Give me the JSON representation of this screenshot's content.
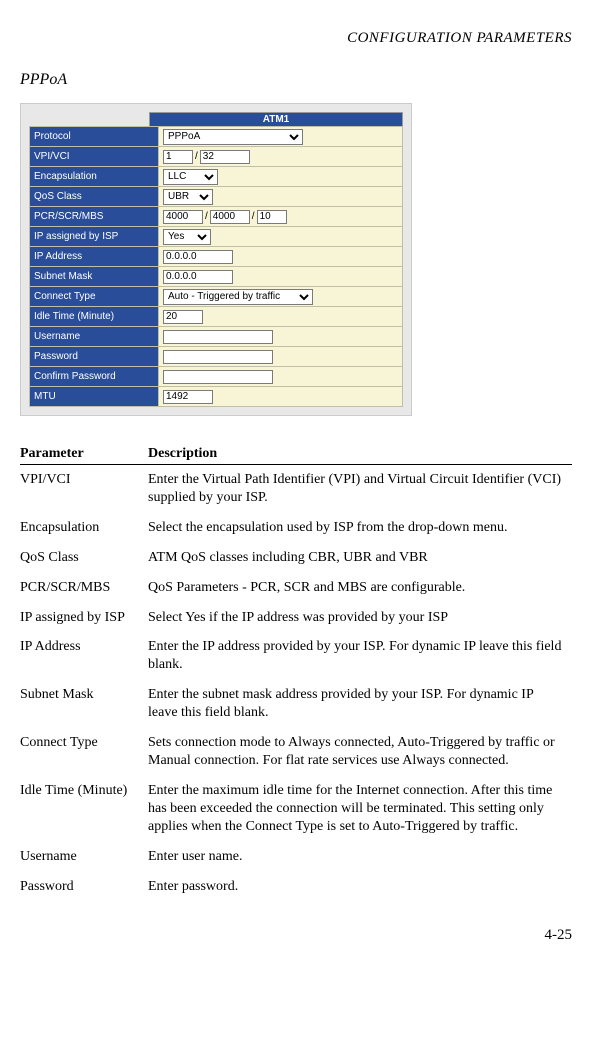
{
  "running_head": "CONFIGURATION PARAMETERS",
  "section_title": "PPPoA",
  "atm": {
    "header": "ATM1",
    "rows": {
      "protocol_label": "Protocol",
      "protocol_value": "PPPoA",
      "vpivci_label": "VPI/VCI",
      "vpi": "1",
      "vci": "32",
      "encap_label": "Encapsulation",
      "encap_value": "LLC",
      "qos_label": "QoS Class",
      "qos_value": "UBR",
      "pcr_label": "PCR/SCR/MBS",
      "pcr": "4000",
      "scr": "4000",
      "mbs": "10",
      "ipassigned_label": "IP assigned by ISP",
      "ipassigned_value": "Yes",
      "ipaddr_label": "IP Address",
      "ipaddr_value": "0.0.0.0",
      "subnet_label": "Subnet Mask",
      "subnet_value": "0.0.0.0",
      "connect_label": "Connect Type",
      "connect_value": "Auto - Triggered by traffic",
      "idle_label": "Idle Time (Minute)",
      "idle_value": "20",
      "user_label": "Username",
      "user_value": "",
      "pass_label": "Password",
      "pass_value": "",
      "confirm_label": "Confirm Password",
      "confirm_value": "",
      "mtu_label": "MTU",
      "mtu_value": "1492"
    }
  },
  "params_header": {
    "param": "Parameter",
    "desc": "Description"
  },
  "params": [
    {
      "name": "VPI/VCI",
      "desc": "Enter the Virtual Path Identifier (VPI) and Virtual Circuit Identifier (VCI) supplied by your ISP."
    },
    {
      "name": "Encapsulation",
      "desc": "Select the encapsulation used by ISP from the drop-down menu."
    },
    {
      "name": "QoS Class",
      "desc": "ATM QoS classes including CBR, UBR and VBR"
    },
    {
      "name": "PCR/SCR/MBS",
      "desc": "QoS Parameters - PCR, SCR and MBS are configurable."
    },
    {
      "name": "IP assigned by ISP",
      "desc": "Select Yes if the IP address was provided by your ISP"
    },
    {
      "name": "IP Address",
      "desc": "Enter the IP address provided by your ISP. For dynamic IP leave this field blank."
    },
    {
      "name": "Subnet Mask",
      "desc": "Enter the subnet mask address provided by your ISP. For dynamic IP leave this field blank."
    },
    {
      "name": "Connect Type",
      "desc": "Sets connection mode to Always connected, Auto-Triggered by traffic or Manual connection. For flat rate services use Always connected."
    },
    {
      "name": "Idle Time (Minute)",
      "desc": "Enter the maximum idle time for the Internet connection. After this time has been exceeded the connection will be terminated. This setting only applies when the Connect Type is set to Auto-Triggered by traffic."
    },
    {
      "name": "Username",
      "desc": "Enter user name."
    },
    {
      "name": "Password",
      "desc": "Enter password."
    }
  ],
  "page_number": "4-25"
}
